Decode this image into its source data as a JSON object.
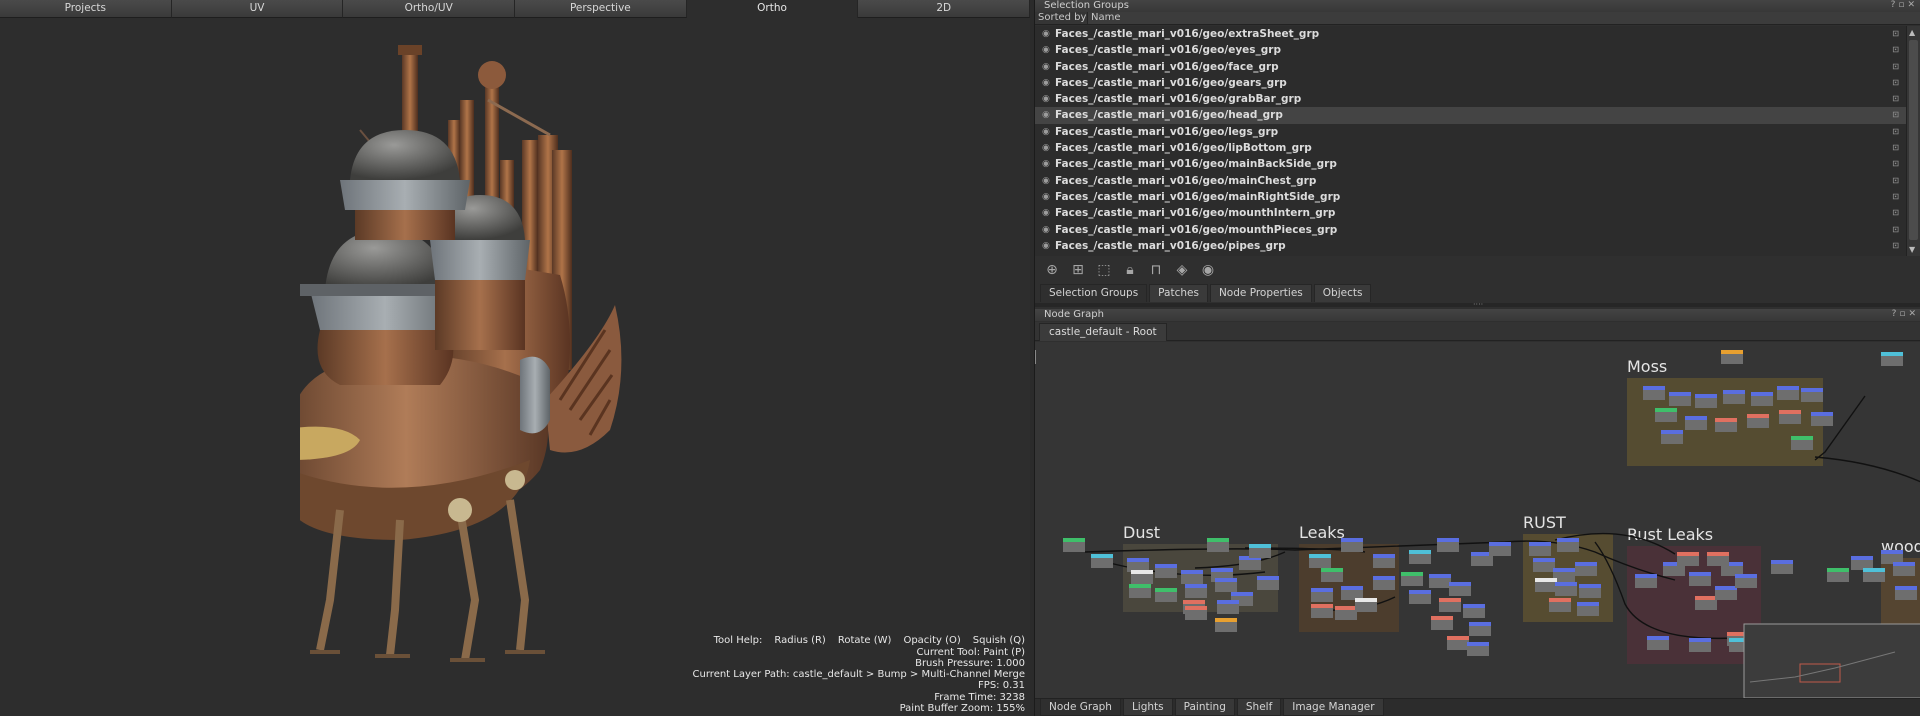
{
  "viewport": {
    "tabs": [
      "Projects",
      "UV",
      "Ortho/UV",
      "Perspective",
      "Ortho",
      "2D"
    ],
    "active_tab": "Ortho",
    "hud": {
      "tool_help_label": "Tool Help:",
      "tool_help_items": [
        "Radius (R)",
        "Rotate (W)",
        "Opacity (O)",
        "Squish (Q)"
      ],
      "current_tool": "Current Tool: Paint (P)",
      "brush_pressure": "Brush Pressure: 1.000",
      "layer_path": "Current Layer Path: castle_default > Bump > Multi-Channel Merge",
      "fps": "FPS: 0.31",
      "frame_time": "Frame Time: 3238",
      "paint_buffer_zoom": "Paint Buffer Zoom: 155%"
    }
  },
  "selection_groups": {
    "title": "Selection Groups",
    "sorted_by_label": "Sorted by",
    "column_name": "Name",
    "items": [
      {
        "label": "Faces_/castle_mari_v016/geo/extraSheet_grp",
        "selected": false
      },
      {
        "label": "Faces_/castle_mari_v016/geo/eyes_grp",
        "selected": false
      },
      {
        "label": "Faces_/castle_mari_v016/geo/face_grp",
        "selected": false
      },
      {
        "label": "Faces_/castle_mari_v016/geo/gears_grp",
        "selected": false
      },
      {
        "label": "Faces_/castle_mari_v016/geo/grabBar_grp",
        "selected": false
      },
      {
        "label": "Faces_/castle_mari_v016/geo/head_grp",
        "selected": true
      },
      {
        "label": "Faces_/castle_mari_v016/geo/legs_grp",
        "selected": false
      },
      {
        "label": "Faces_/castle_mari_v016/geo/lipBottom_grp",
        "selected": false
      },
      {
        "label": "Faces_/castle_mari_v016/geo/mainBackSide_grp",
        "selected": false
      },
      {
        "label": "Faces_/castle_mari_v016/geo/mainChest_grp",
        "selected": false
      },
      {
        "label": "Faces_/castle_mari_v016/geo/mainRightSide_grp",
        "selected": false
      },
      {
        "label": "Faces_/castle_mari_v016/geo/mounthIntern_grp",
        "selected": false
      },
      {
        "label": "Faces_/castle_mari_v016/geo/mounthPieces_grp",
        "selected": false
      },
      {
        "label": "Faces_/castle_mari_v016/geo/pipes_grp",
        "selected": false
      }
    ],
    "toolbar_icons": [
      "add-group-icon",
      "add-from-selection-icon",
      "select-icon",
      "lock-icon",
      "unlock-icon",
      "visibility-icon",
      "eye-icon"
    ],
    "tabs": [
      "Selection Groups",
      "Patches",
      "Node Properties",
      "Objects"
    ],
    "active_tab": "Selection Groups"
  },
  "node_graph": {
    "title": "Node Graph",
    "tab": "castle_default - Root",
    "backdrops": [
      {
        "label": "Moss",
        "color": "#5a5030"
      },
      {
        "label": "Dust",
        "color": "#4e4a3e"
      },
      {
        "label": "Leaks",
        "color": "#503e2c"
      },
      {
        "label": "RUST",
        "color": "#5c5030"
      },
      {
        "label": "Rust Leaks",
        "color": "#4e3038"
      },
      {
        "label": "wood",
        "color": "#5a4830"
      }
    ],
    "node_colors": {
      "blue": "#5a6ee0",
      "green": "#3fbf6a",
      "salmon": "#e07060",
      "orange": "#e8a030",
      "white": "#e8e8e8",
      "cyan": "#4fc0d8",
      "gray": "#6e6e6e"
    }
  },
  "bottom_tabs": [
    "Node Graph",
    "Lights",
    "Painting",
    "Shelf",
    "Image Manager"
  ],
  "bottom_active": "Node Graph"
}
